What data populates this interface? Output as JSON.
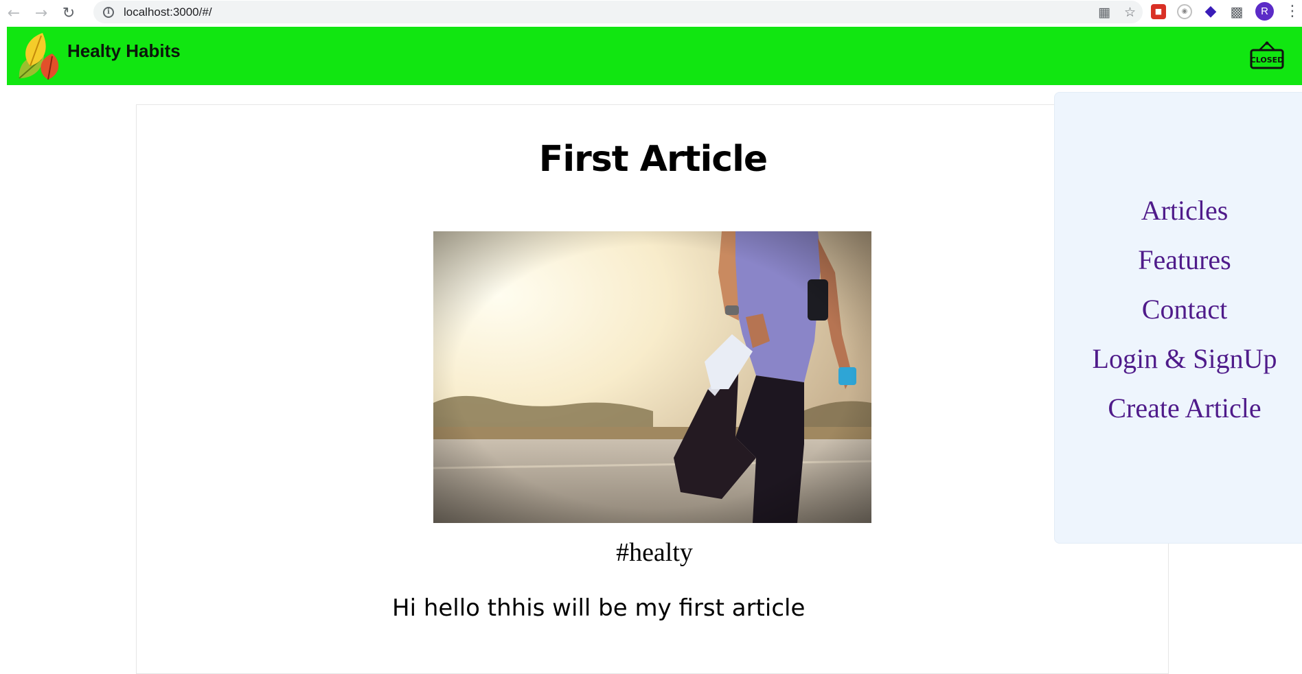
{
  "browser": {
    "url": "localhost:3000/#/",
    "avatar_letter": "R"
  },
  "header": {
    "brand": "Healty Habits",
    "sign_text": "CLOSED"
  },
  "article": {
    "title": "First Article",
    "tag": "#healty",
    "body": "Hi hello thhis will be my first article"
  },
  "menu": {
    "items": [
      "Articles",
      "Features",
      "Contact",
      "Login & SignUp",
      "Create Article"
    ]
  },
  "colors": {
    "header_bg": "#11e611",
    "menu_bg": "#eef5fd",
    "menu_text": "#4f1b8a"
  }
}
